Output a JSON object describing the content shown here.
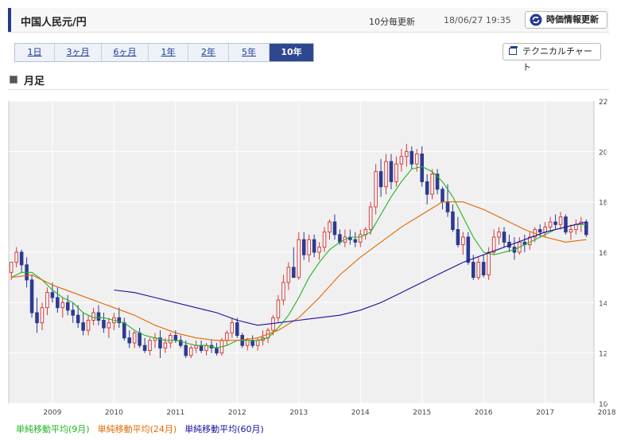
{
  "header": {
    "title": "中国人民元/円",
    "update_freq": "10分毎更新",
    "timestamp": "18/06/27 19:35",
    "refresh_label": "時価情報更新"
  },
  "tabs": [
    {
      "label": "1日",
      "active": false
    },
    {
      "label": "3ヶ月",
      "active": false
    },
    {
      "label": "6ヶ月",
      "active": false
    },
    {
      "label": "1年",
      "active": false
    },
    {
      "label": "2年",
      "active": false
    },
    {
      "label": "5年",
      "active": false
    },
    {
      "label": "10年",
      "active": true
    }
  ],
  "technical_chart_label": "テクニカルチャート",
  "section_title": "月足",
  "legend": [
    {
      "label": "単純移動平均(9月)",
      "color": "#22b422"
    },
    {
      "label": "単純移動平均(24月)",
      "color": "#e06a00"
    },
    {
      "label": "単純移動平均(60月)",
      "color": "#1a0fa0"
    }
  ],
  "chart_data": {
    "type": "candlestick",
    "interval": "monthly",
    "ylim": [
      10,
      22
    ],
    "yticks": [
      "10",
      "12",
      "14",
      "16",
      "18",
      "20",
      "22"
    ],
    "xticks": [
      "2009",
      "2010",
      "2011",
      "2012",
      "2013",
      "2014",
      "2015",
      "2016",
      "2017",
      "2018"
    ],
    "grid": true,
    "up_color": "#d33a3a",
    "down_color": "#2c3a90",
    "ohlc": [
      [
        15.2,
        15.5,
        14.9,
        15.6
      ],
      [
        15.6,
        16.2,
        15.4,
        16.0
      ],
      [
        16.0,
        16.1,
        15.2,
        15.5
      ],
      [
        15.5,
        15.8,
        14.6,
        14.9
      ],
      [
        14.9,
        15.1,
        13.4,
        13.6
      ],
      [
        13.6,
        14.2,
        12.8,
        13.2
      ],
      [
        13.2,
        14.0,
        12.9,
        13.8
      ],
      [
        13.8,
        14.6,
        13.5,
        14.4
      ],
      [
        14.4,
        14.8,
        14.0,
        14.2
      ],
      [
        14.2,
        14.6,
        13.6,
        13.8
      ],
      [
        13.8,
        14.2,
        13.4,
        14.0
      ],
      [
        14.0,
        14.3,
        13.5,
        13.7
      ],
      [
        13.7,
        14.0,
        13.2,
        13.5
      ],
      [
        13.5,
        13.9,
        13.0,
        13.2
      ],
      [
        13.2,
        13.6,
        12.7,
        12.9
      ],
      [
        12.9,
        13.5,
        12.7,
        13.3
      ],
      [
        13.3,
        13.8,
        13.1,
        13.6
      ],
      [
        13.6,
        13.9,
        13.1,
        13.3
      ],
      [
        13.3,
        13.6,
        12.8,
        13.0
      ],
      [
        13.0,
        13.4,
        12.6,
        13.2
      ],
      [
        13.2,
        13.6,
        12.9,
        13.4
      ],
      [
        13.4,
        13.8,
        13.0,
        13.2
      ],
      [
        13.2,
        13.4,
        12.5,
        12.6
      ],
      [
        12.6,
        12.9,
        12.2,
        12.4
      ],
      [
        12.4,
        12.9,
        12.2,
        12.8
      ],
      [
        12.8,
        13.0,
        12.2,
        12.3
      ],
      [
        12.3,
        12.6,
        12.0,
        12.1
      ],
      [
        12.1,
        12.6,
        11.9,
        12.5
      ],
      [
        12.5,
        12.8,
        12.2,
        12.6
      ],
      [
        12.6,
        12.9,
        11.8,
        12.2
      ],
      [
        12.2,
        12.6,
        12.0,
        12.4
      ],
      [
        12.4,
        12.8,
        12.2,
        12.7
      ],
      [
        12.7,
        12.9,
        12.4,
        12.5
      ],
      [
        12.5,
        12.7,
        12.2,
        12.3
      ],
      [
        12.3,
        12.5,
        11.8,
        11.9
      ],
      [
        11.9,
        12.3,
        11.8,
        12.2
      ],
      [
        12.2,
        12.5,
        12.0,
        12.3
      ],
      [
        12.3,
        12.5,
        12.0,
        12.1
      ],
      [
        12.1,
        12.4,
        11.9,
        12.3
      ],
      [
        12.3,
        12.5,
        12.0,
        12.2
      ],
      [
        12.2,
        12.4,
        11.9,
        12.0
      ],
      [
        12.0,
        12.6,
        11.9,
        12.5
      ],
      [
        12.5,
        12.9,
        12.3,
        12.8
      ],
      [
        12.8,
        13.4,
        12.6,
        13.2
      ],
      [
        13.2,
        13.4,
        12.6,
        12.7
      ],
      [
        12.7,
        12.8,
        12.2,
        12.3
      ],
      [
        12.3,
        12.6,
        12.1,
        12.5
      ],
      [
        12.5,
        12.7,
        12.2,
        12.3
      ],
      [
        12.3,
        12.6,
        12.1,
        12.5
      ],
      [
        12.5,
        12.9,
        12.3,
        12.6
      ],
      [
        12.6,
        13.0,
        12.4,
        12.9
      ],
      [
        12.9,
        13.5,
        12.7,
        13.4
      ],
      [
        13.4,
        14.3,
        13.2,
        14.1
      ],
      [
        14.1,
        15.1,
        13.9,
        14.8
      ],
      [
        14.8,
        15.6,
        14.5,
        15.4
      ],
      [
        15.4,
        16.2,
        15.0,
        15.0
      ],
      [
        15.0,
        16.8,
        14.9,
        16.5
      ],
      [
        16.5,
        16.8,
        15.7,
        15.9
      ],
      [
        15.9,
        16.7,
        15.6,
        16.5
      ],
      [
        16.5,
        16.7,
        15.8,
        16.0
      ],
      [
        16.0,
        16.4,
        15.7,
        16.2
      ],
      [
        16.2,
        17.0,
        16.0,
        16.8
      ],
      [
        16.8,
        17.3,
        16.5,
        17.2
      ],
      [
        17.2,
        17.5,
        16.5,
        16.7
      ],
      [
        16.7,
        16.9,
        16.3,
        16.4
      ],
      [
        16.4,
        16.9,
        16.2,
        16.6
      ],
      [
        16.6,
        16.9,
        16.3,
        16.5
      ],
      [
        16.5,
        16.8,
        16.2,
        16.4
      ],
      [
        16.4,
        16.9,
        16.2,
        16.7
      ],
      [
        16.7,
        17.0,
        16.5,
        16.9
      ],
      [
        16.9,
        18.0,
        16.7,
        17.8
      ],
      [
        17.8,
        19.5,
        17.5,
        19.2
      ],
      [
        19.2,
        19.7,
        18.2,
        18.6
      ],
      [
        18.6,
        19.9,
        18.3,
        19.6
      ],
      [
        19.6,
        19.9,
        18.5,
        18.8
      ],
      [
        18.8,
        19.8,
        18.6,
        19.5
      ],
      [
        19.5,
        20.1,
        19.2,
        19.8
      ],
      [
        19.8,
        20.3,
        19.4,
        20.0
      ],
      [
        20.0,
        20.2,
        19.3,
        19.5
      ],
      [
        19.5,
        20.1,
        19.2,
        19.9
      ],
      [
        19.9,
        20.2,
        18.6,
        18.8
      ],
      [
        18.8,
        19.1,
        17.9,
        18.3
      ],
      [
        18.3,
        19.3,
        18.1,
        19.1
      ],
      [
        19.1,
        19.3,
        18.3,
        18.5
      ],
      [
        18.5,
        18.6,
        17.7,
        18.0
      ],
      [
        18.0,
        18.7,
        17.4,
        17.6
      ],
      [
        17.6,
        17.9,
        16.8,
        16.9
      ],
      [
        16.9,
        17.4,
        16.2,
        16.3
      ],
      [
        16.3,
        16.8,
        15.9,
        16.6
      ],
      [
        16.6,
        16.8,
        15.5,
        15.6
      ],
      [
        15.6,
        15.9,
        14.9,
        15.0
      ],
      [
        15.0,
        15.8,
        14.9,
        15.6
      ],
      [
        15.6,
        15.9,
        15.0,
        15.1
      ],
      [
        15.1,
        16.2,
        14.9,
        16.0
      ],
      [
        16.0,
        16.9,
        15.9,
        16.6
      ],
      [
        16.6,
        17.0,
        16.3,
        16.8
      ],
      [
        16.8,
        17.0,
        16.2,
        16.4
      ],
      [
        16.4,
        16.7,
        16.0,
        16.2
      ],
      [
        16.2,
        16.6,
        15.7,
        16.0
      ],
      [
        16.0,
        16.6,
        15.9,
        16.4
      ],
      [
        16.4,
        16.7,
        16.0,
        16.3
      ],
      [
        16.3,
        16.8,
        16.1,
        16.6
      ],
      [
        16.6,
        17.0,
        16.4,
        16.9
      ],
      [
        16.9,
        17.1,
        16.6,
        16.8
      ],
      [
        16.8,
        17.2,
        16.6,
        17.0
      ],
      [
        17.0,
        17.4,
        16.8,
        17.2
      ],
      [
        17.2,
        17.5,
        16.9,
        17.1
      ],
      [
        17.1,
        17.6,
        16.9,
        17.4
      ],
      [
        17.4,
        17.5,
        16.7,
        16.8
      ],
      [
        16.8,
        17.1,
        16.5,
        16.9
      ],
      [
        16.9,
        17.3,
        16.7,
        17.1
      ],
      [
        17.1,
        17.4,
        16.8,
        17.2
      ],
      [
        17.2,
        17.3,
        16.6,
        16.7
      ]
    ],
    "ma_lines": [
      {
        "name": "単純移動平均(9月)",
        "color": "#22b422",
        "points": [
          [
            0,
            15.0
          ],
          [
            2,
            15.2
          ],
          [
            4,
            15.2
          ],
          [
            6,
            14.9
          ],
          [
            8,
            14.5
          ],
          [
            10,
            14.2
          ],
          [
            12,
            14.0
          ],
          [
            14,
            13.6
          ],
          [
            16,
            13.4
          ],
          [
            18,
            13.4
          ],
          [
            20,
            13.3
          ],
          [
            22,
            13.2
          ],
          [
            24,
            12.9
          ],
          [
            26,
            12.7
          ],
          [
            28,
            12.6
          ],
          [
            30,
            12.5
          ],
          [
            32,
            12.5
          ],
          [
            34,
            12.4
          ],
          [
            36,
            12.3
          ],
          [
            38,
            12.3
          ],
          [
            40,
            12.2
          ],
          [
            42,
            12.3
          ],
          [
            44,
            12.5
          ],
          [
            46,
            12.5
          ],
          [
            48,
            12.5
          ],
          [
            50,
            12.6
          ],
          [
            52,
            13.0
          ],
          [
            54,
            13.5
          ],
          [
            56,
            14.2
          ],
          [
            58,
            15.0
          ],
          [
            60,
            15.6
          ],
          [
            62,
            16.1
          ],
          [
            64,
            16.4
          ],
          [
            66,
            16.6
          ],
          [
            68,
            16.6
          ],
          [
            70,
            16.8
          ],
          [
            72,
            17.5
          ],
          [
            74,
            18.2
          ],
          [
            76,
            18.8
          ],
          [
            78,
            19.3
          ],
          [
            80,
            19.4
          ],
          [
            82,
            19.2
          ],
          [
            84,
            18.8
          ],
          [
            86,
            18.2
          ],
          [
            88,
            17.4
          ],
          [
            90,
            16.6
          ],
          [
            92,
            16.0
          ],
          [
            94,
            15.9
          ],
          [
            96,
            16.0
          ],
          [
            98,
            16.1
          ],
          [
            100,
            16.3
          ],
          [
            102,
            16.5
          ],
          [
            104,
            16.7
          ],
          [
            106,
            16.9
          ],
          [
            108,
            17.0
          ],
          [
            110,
            17.1
          ],
          [
            112,
            17.1
          ]
        ]
      },
      {
        "name": "単純移動平均(24月)",
        "color": "#e06a00",
        "points": [
          [
            0,
            15.0
          ],
          [
            4,
            15.1
          ],
          [
            8,
            14.7
          ],
          [
            12,
            14.4
          ],
          [
            16,
            14.1
          ],
          [
            20,
            13.8
          ],
          [
            24,
            13.5
          ],
          [
            28,
            13.1
          ],
          [
            32,
            12.8
          ],
          [
            36,
            12.6
          ],
          [
            40,
            12.5
          ],
          [
            44,
            12.5
          ],
          [
            48,
            12.6
          ],
          [
            52,
            12.9
          ],
          [
            56,
            13.4
          ],
          [
            60,
            14.2
          ],
          [
            64,
            15.1
          ],
          [
            68,
            15.8
          ],
          [
            72,
            16.4
          ],
          [
            76,
            17.0
          ],
          [
            80,
            17.5
          ],
          [
            84,
            18.0
          ],
          [
            88,
            18.0
          ],
          [
            92,
            17.7
          ],
          [
            96,
            17.3
          ],
          [
            100,
            16.9
          ],
          [
            104,
            16.6
          ],
          [
            108,
            16.4
          ],
          [
            112,
            16.5
          ]
        ]
      },
      {
        "name": "単純移動平均(60月)",
        "color": "#1a0fa0",
        "points": [
          [
            20,
            14.5
          ],
          [
            24,
            14.4
          ],
          [
            28,
            14.2
          ],
          [
            32,
            14.0
          ],
          [
            36,
            13.8
          ],
          [
            40,
            13.6
          ],
          [
            44,
            13.3
          ],
          [
            48,
            13.1
          ],
          [
            52,
            13.2
          ],
          [
            56,
            13.3
          ],
          [
            60,
            13.4
          ],
          [
            64,
            13.5
          ],
          [
            68,
            13.7
          ],
          [
            72,
            14.0
          ],
          [
            76,
            14.4
          ],
          [
            80,
            14.8
          ],
          [
            84,
            15.2
          ],
          [
            88,
            15.6
          ],
          [
            92,
            15.9
          ],
          [
            96,
            16.2
          ],
          [
            100,
            16.5
          ],
          [
            104,
            16.8
          ],
          [
            108,
            17.0
          ],
          [
            112,
            17.2
          ]
        ]
      }
    ]
  }
}
